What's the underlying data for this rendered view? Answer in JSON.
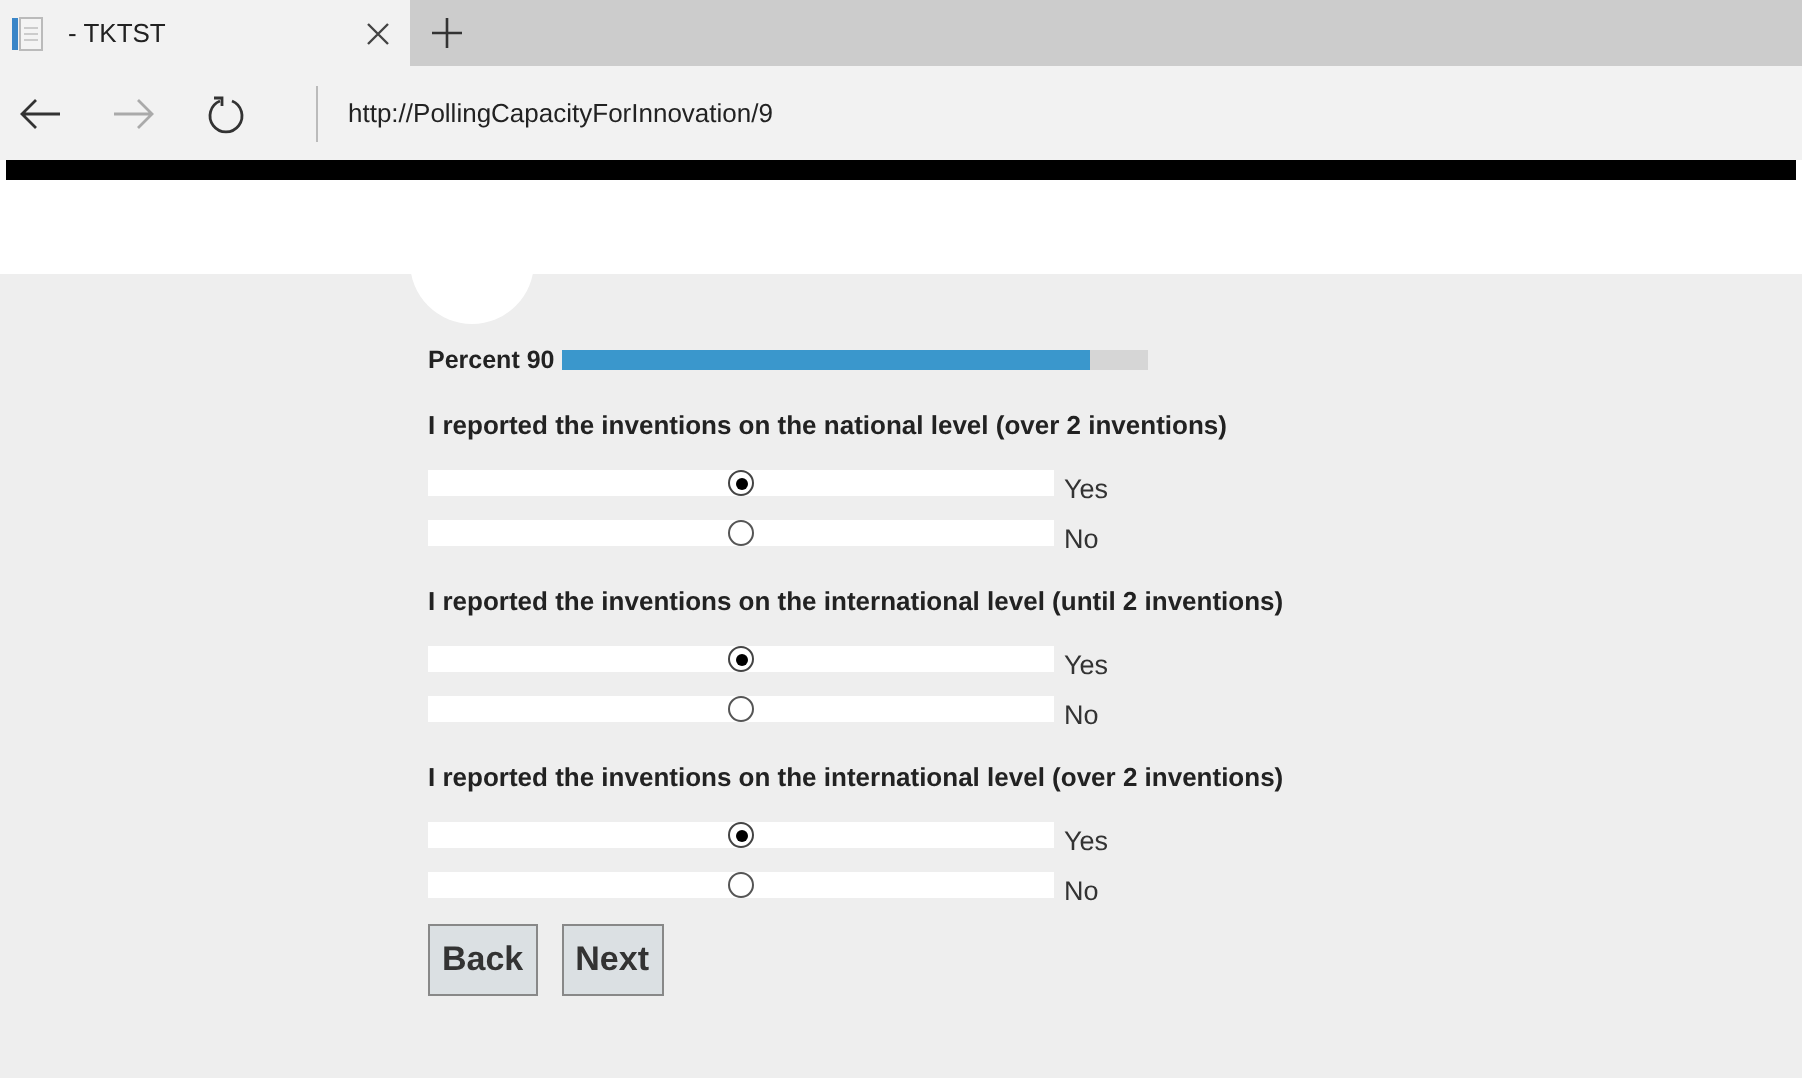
{
  "browser": {
    "tab_title": "- TKTST",
    "address": "http://PollingCapacityForInnovation/9"
  },
  "progress": {
    "label": "Percent 90",
    "level": 0.9
  },
  "questions": [
    {
      "text": "I reported the inventions on the national level (over 2 inventions)",
      "options": [
        {
          "label": "Yes",
          "selected": true
        },
        {
          "label": "No",
          "selected": false
        }
      ]
    },
    {
      "text": "I reported the inventions on the international level (until 2 inventions)",
      "options": [
        {
          "label": "Yes",
          "selected": true
        },
        {
          "label": "No",
          "selected": false
        }
      ]
    },
    {
      "text": "I reported the inventions on the international level (over 2 inventions)",
      "options": [
        {
          "label": "Yes",
          "selected": true
        },
        {
          "label": "No",
          "selected": false
        }
      ]
    }
  ],
  "buttons": [
    "Back",
    "Next"
  ]
}
